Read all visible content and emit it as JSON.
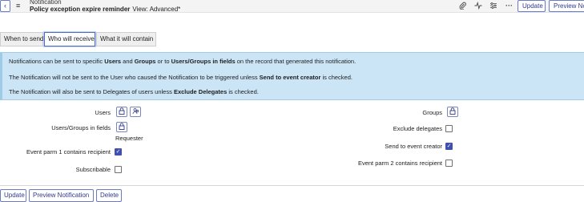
{
  "header": {
    "record_type": "Notification",
    "record_name": "Policy exception expire reminder",
    "view_label": "View: Advanced*",
    "back_icon": "chevron-left-icon",
    "menu_icon": "hamburger-menu-icon",
    "attach_icon": "paperclip-icon",
    "activity_icon": "activity-pulse-icon",
    "settings_icon": "sliders-icon",
    "more_icon": "more-options-icon",
    "update_label": "Update",
    "preview_label": "Preview No"
  },
  "tabs": [
    {
      "label": "When to send",
      "active": false
    },
    {
      "label": "Who will receive",
      "active": true
    },
    {
      "label": "What it will contain",
      "active": false
    }
  ],
  "info": {
    "line1": "Notifications can be sent to specific Users and Groups or to Users/Groups in fields on the record that generated this notification.",
    "line2": "The Notification will not be sent to the User who caused the Notification to be triggered unless Send to event creator is checked.",
    "line3": "The Notification will also be sent to Delegates of users unless Exclude Delegates is checked."
  },
  "form": {
    "users_label": "Users",
    "users_groups_fields_label": "Users/Groups in fields",
    "users_groups_fields_value": "Requester",
    "event_parm1_label": "Event parm 1 contains recipient",
    "event_parm1_checked": true,
    "subscribable_label": "Subscribable",
    "subscribable_checked": false,
    "groups_label": "Groups",
    "exclude_delegates_label": "Exclude delegates",
    "exclude_delegates_checked": false,
    "send_to_creator_label": "Send to event creator",
    "send_to_creator_checked": true,
    "event_parm2_label": "Event parm 2 contains recipient",
    "event_parm2_checked": false,
    "lock_icon": "lock-icon",
    "unlock_icon": "unlock-icon",
    "check_glyph": "✓"
  },
  "footer": {
    "update_label": "Update",
    "preview_label": "Preview Notification",
    "delete_label": "Delete"
  },
  "colors": {
    "accent": "#303b8c",
    "info_bg": "#cbe5f7",
    "checkbox_checked": "#4050b0"
  }
}
